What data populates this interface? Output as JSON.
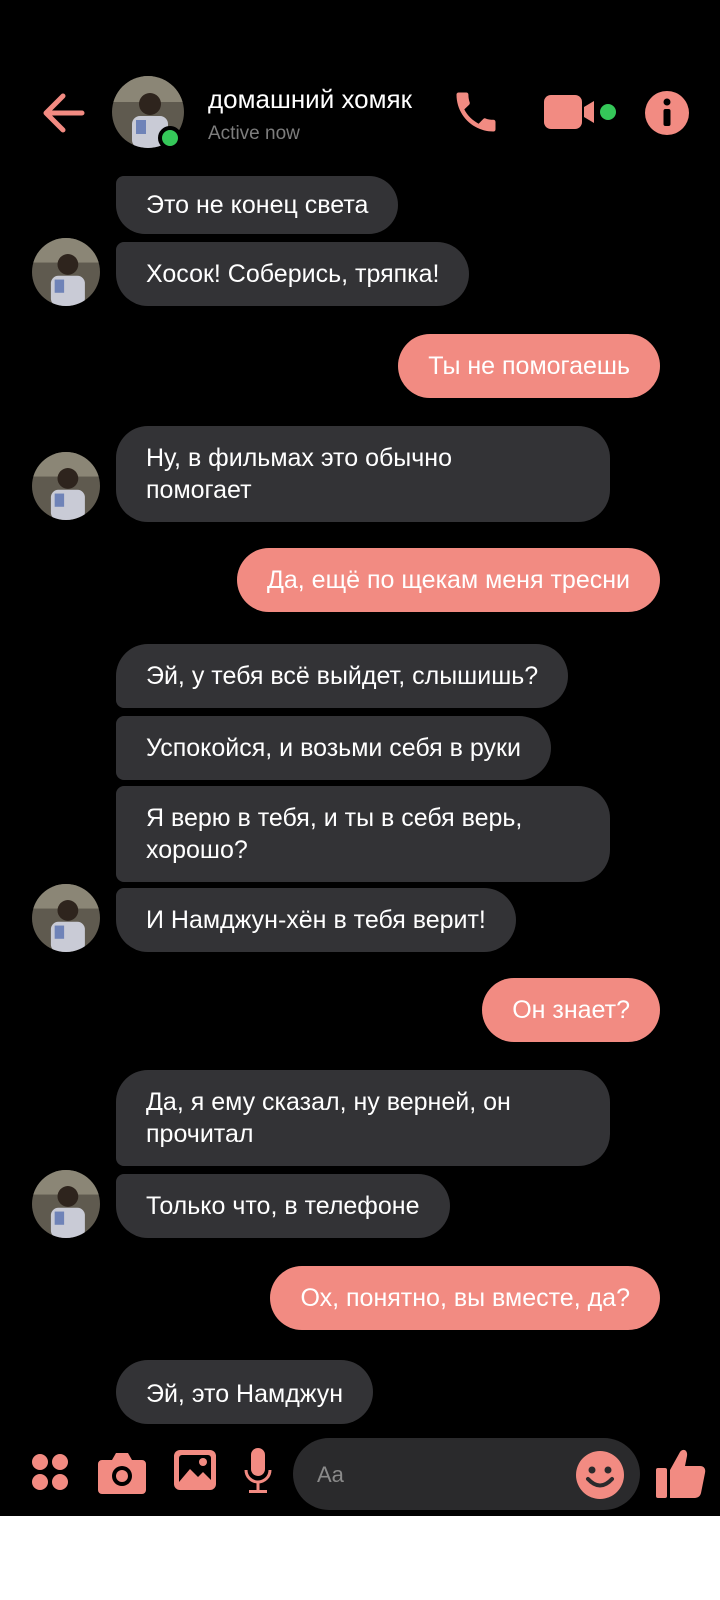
{
  "colors": {
    "accent": "#f28b82",
    "received_bubble": "#333336",
    "online": "#35c759",
    "background": "#000000"
  },
  "header": {
    "back_icon": "arrow-left-icon",
    "contact_name": "домашний хомяк",
    "status": "Active now",
    "call_icon": "phone-icon",
    "video_icon": "video-camera-icon",
    "info_icon": "info-icon"
  },
  "messages": [
    {
      "side": "received",
      "text": "Это не конец света",
      "avatar": false
    },
    {
      "side": "received",
      "text": "Хосок! Соберись, тряпка!",
      "avatar": true
    },
    {
      "side": "sent",
      "text": "Ты не помогаешь"
    },
    {
      "side": "received",
      "text": "Ну, в фильмах это обычно\nпомогает",
      "avatar": true
    },
    {
      "side": "sent",
      "text": "Да, ещё по щекам меня тресни"
    },
    {
      "side": "received",
      "text": "Эй, у тебя всё выйдет, слышишь?",
      "avatar": false
    },
    {
      "side": "received",
      "text": "Успокойся, и возьми себя в руки",
      "avatar": false
    },
    {
      "side": "received",
      "text": "Я верю в тебя, и ты в себя верь,\nхорошо?",
      "avatar": false
    },
    {
      "side": "received",
      "text": "И Намджун-хён в тебя верит!",
      "avatar": true
    },
    {
      "side": "sent",
      "text": "Он знает?"
    },
    {
      "side": "received",
      "text": "Да, я ему сказал, ну верней, он\nпрочитал",
      "avatar": false
    },
    {
      "side": "received",
      "text": "Только что, в телефоне",
      "avatar": true
    },
    {
      "side": "sent",
      "text": "Ох, понятно, вы вместе, да?"
    },
    {
      "side": "received",
      "text": "Эй, это Намджун",
      "avatar": false
    }
  ],
  "input_bar": {
    "menu_icon": "four-dots-menu-icon",
    "camera_icon": "camera-icon",
    "gallery_icon": "image-icon",
    "mic_icon": "microphone-icon",
    "placeholder": "Aa",
    "emoji_icon": "smiley-emoji-icon",
    "like_icon": "thumbs-up-icon"
  }
}
